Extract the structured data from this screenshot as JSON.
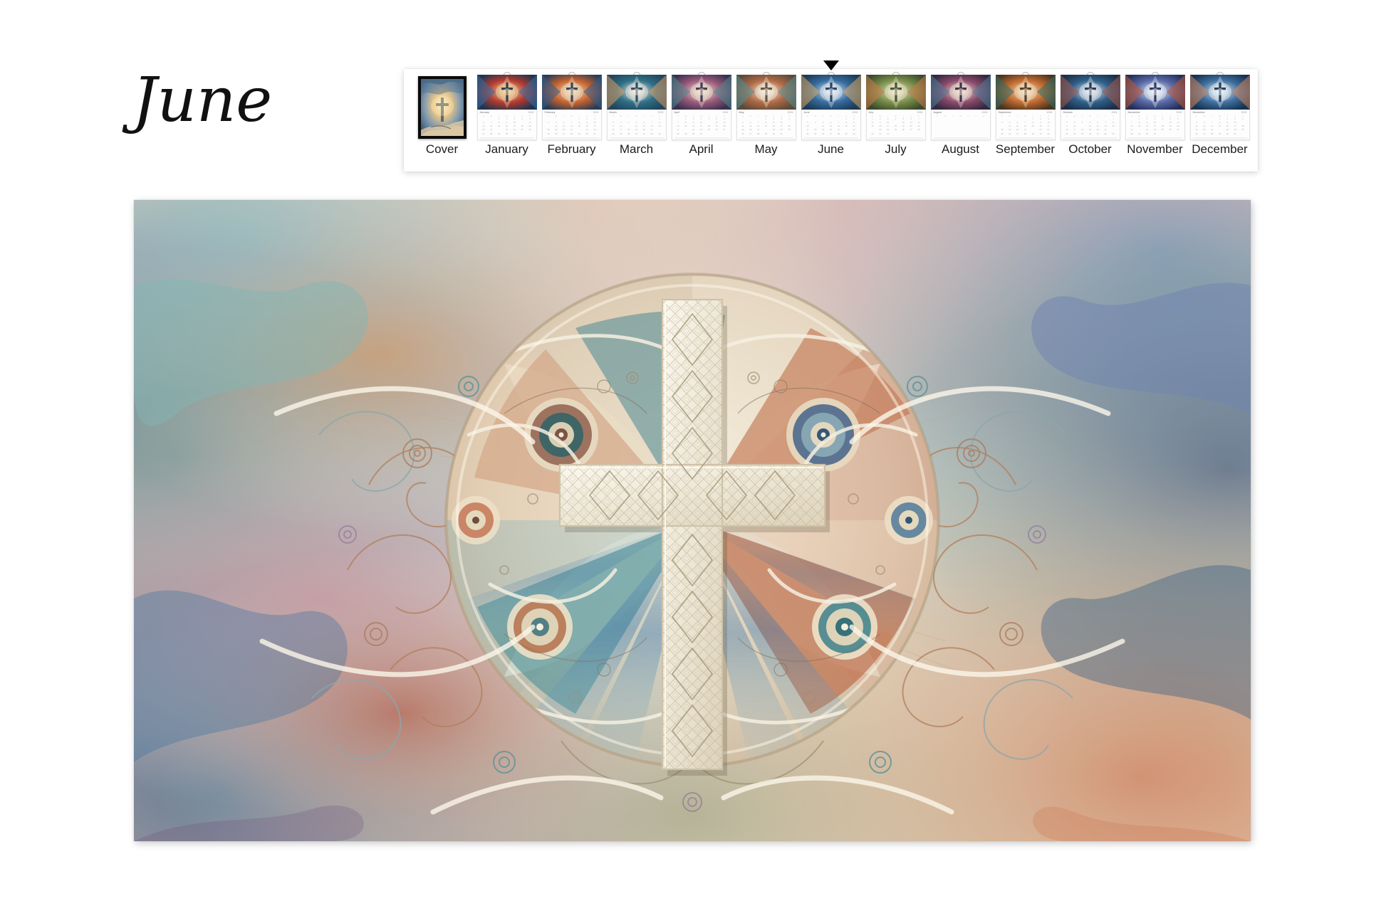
{
  "page": {
    "background_color": "#ffffff",
    "month_title": "June"
  },
  "thumbnail_strip": {
    "selected_index": 6,
    "pointer_icon": "triangle-down-icon",
    "panel_color": "#ffffff",
    "items": [
      {
        "label": "Cover",
        "type": "cover",
        "month": "Cover",
        "year": ""
      },
      {
        "label": "January",
        "type": "calendar",
        "month": "January",
        "year": "2024"
      },
      {
        "label": "February",
        "type": "calendar",
        "month": "February",
        "year": "2024"
      },
      {
        "label": "March",
        "type": "calendar",
        "month": "March",
        "year": "2024"
      },
      {
        "label": "April",
        "type": "calendar",
        "month": "April",
        "year": "2024"
      },
      {
        "label": "May",
        "type": "calendar",
        "month": "May",
        "year": "2024"
      },
      {
        "label": "June",
        "type": "calendar",
        "month": "June",
        "year": "2024"
      },
      {
        "label": "July",
        "type": "calendar",
        "month": "July",
        "year": "2024"
      },
      {
        "label": "August",
        "type": "calendar",
        "month": "August",
        "year": "2024"
      },
      {
        "label": "September",
        "type": "calendar",
        "month": "September",
        "year": "2024"
      },
      {
        "label": "October",
        "type": "calendar",
        "month": "October",
        "year": "2024"
      },
      {
        "label": "November",
        "type": "calendar",
        "month": "November",
        "year": "2024"
      },
      {
        "label": "December",
        "type": "calendar",
        "month": "December",
        "year": "2024"
      }
    ],
    "day_initials": [
      "S",
      "M",
      "T",
      "W",
      "T",
      "F",
      "S"
    ]
  },
  "main_artwork": {
    "subject": "ornamental watercolor mandala with central stone cross",
    "palette": {
      "cream": "#f4efe0",
      "ivory": "#efe8d6",
      "terracotta": "#c8714a",
      "rust": "#a9472a",
      "teal": "#4e8f96",
      "deep_teal": "#2f6b74",
      "slate_blue": "#5b7fa6",
      "deep_blue": "#27527c",
      "sage": "#8a9a72",
      "plum": "#7a5068",
      "rose": "#cf9aa4",
      "peach": "#e8b58c",
      "ink": "#3a332b"
    }
  }
}
